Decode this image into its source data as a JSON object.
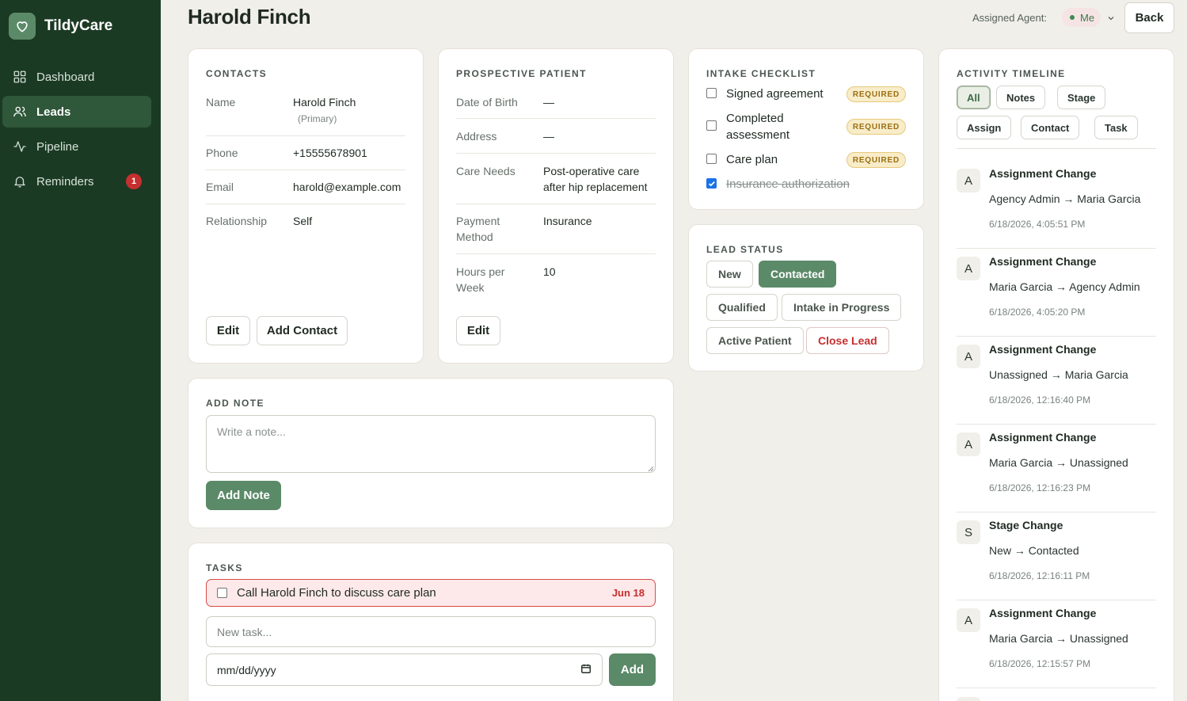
{
  "app": {
    "name": "TildyCare"
  },
  "sidebar": {
    "items": [
      {
        "label": "Dashboard",
        "icon": "grid-icon"
      },
      {
        "label": "Leads",
        "icon": "users-icon",
        "active": true
      },
      {
        "label": "Pipeline",
        "icon": "activity-icon"
      },
      {
        "label": "Reminders",
        "icon": "bell-icon",
        "badge": "1"
      }
    ]
  },
  "header": {
    "title": "Harold Finch",
    "agent_label": "Assigned Agent:",
    "agent_value": "Me",
    "back_label": "Back"
  },
  "contacts": {
    "title": "CONTACTS",
    "rows": [
      {
        "label": "Name",
        "value": "Harold Finch",
        "sub": "(Primary)"
      },
      {
        "label": "Phone",
        "value": "+15555678901"
      },
      {
        "label": "Email",
        "value": "harold@example.com"
      },
      {
        "label": "Relationship",
        "value": "Self"
      }
    ],
    "edit_label": "Edit",
    "add_label": "Add Contact"
  },
  "patient": {
    "title": "PROSPECTIVE PATIENT",
    "rows": [
      {
        "label": "Date of Birth",
        "value": "—"
      },
      {
        "label": "Address",
        "value": "—"
      },
      {
        "label": "Care Needs",
        "value": "Post-operative care after hip replacement"
      },
      {
        "label": "Payment Method",
        "value": "Insurance"
      },
      {
        "label": "Hours per Week",
        "value": "10"
      }
    ],
    "edit_label": "Edit"
  },
  "checklist": {
    "title": "INTAKE CHECKLIST",
    "items": [
      {
        "label": "Signed agreement",
        "checked": false,
        "badge": "REQUIRED"
      },
      {
        "label": "Completed assessment",
        "checked": false,
        "badge": "REQUIRED"
      },
      {
        "label": "Care plan",
        "checked": false,
        "badge": "REQUIRED"
      },
      {
        "label": "Insurance authorization",
        "checked": true
      }
    ]
  },
  "lead_status": {
    "title": "LEAD STATUS",
    "options": [
      "New",
      "Contacted",
      "Qualified",
      "Intake in Progress",
      "Active Patient",
      "Close Lead"
    ],
    "selected": "Contacted"
  },
  "note": {
    "title": "ADD NOTE",
    "placeholder": "Write a note...",
    "button": "Add Note"
  },
  "tasks": {
    "title": "TASKS",
    "items": [
      {
        "text": "Call Harold Finch to discuss care plan",
        "date": "Jun 18",
        "overdue": true
      }
    ],
    "new_placeholder": "New task...",
    "date_placeholder": "mm/dd/yyyy",
    "add_label": "Add"
  },
  "timeline": {
    "title": "ACTIVITY TIMELINE",
    "filters": [
      "All",
      "Notes",
      "Stage",
      "Assign",
      "Contact",
      "Task"
    ],
    "active_filter": "All",
    "items": [
      {
        "avatar": "A",
        "title": "Assignment Change",
        "desc": "Agency Admin → Maria Garcia",
        "time": "6/18/2026, 4:05:51 PM"
      },
      {
        "avatar": "A",
        "title": "Assignment Change",
        "desc": "Maria Garcia → Agency Admin",
        "time": "6/18/2026, 4:05:20 PM"
      },
      {
        "avatar": "A",
        "title": "Assignment Change",
        "desc": "Unassigned → Maria Garcia",
        "time": "6/18/2026, 12:16:40 PM"
      },
      {
        "avatar": "A",
        "title": "Assignment Change",
        "desc": "Maria Garcia → Unassigned",
        "time": "6/18/2026, 12:16:23 PM"
      },
      {
        "avatar": "S",
        "title": "Stage Change",
        "desc": "New → Contacted",
        "time": "6/18/2026, 12:16:11 PM"
      },
      {
        "avatar": "A",
        "title": "Assignment Change",
        "desc": "Maria Garcia → Unassigned",
        "time": "6/18/2026, 12:15:57 PM"
      }
    ]
  },
  "colors": {
    "sidebar_bg": "#1b3a24",
    "accent": "#5b8a68",
    "danger": "#c62f2f",
    "page_bg": "#f1efea"
  }
}
